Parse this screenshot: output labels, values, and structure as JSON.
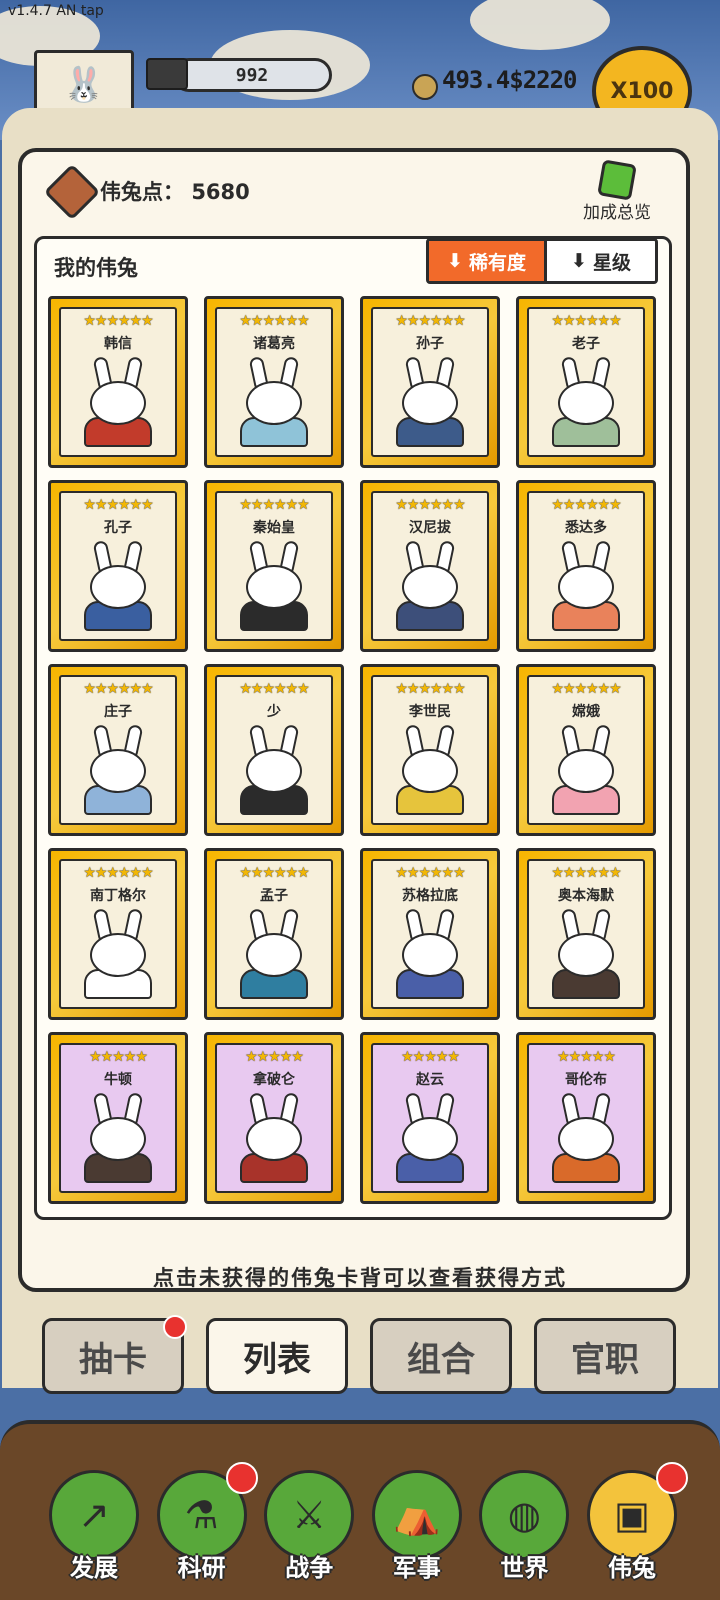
{
  "version": "v1.4.7 AN tap",
  "top_bar": {
    "troops": "992",
    "money": "493.4$2220",
    "multiplier": "X100"
  },
  "panel": {
    "points_label": "伟兔点：",
    "points_value": "5680",
    "bonus_label": "加成总览",
    "section_title": "我的伟兔",
    "sort_rarity": "稀有度",
    "sort_level": "星级"
  },
  "cards": [
    {
      "name": "韩信",
      "stars": "★★★★★★",
      "tier": "gold",
      "robe": "#c23b2b"
    },
    {
      "name": "诸葛亮",
      "stars": "★★★★★★",
      "tier": "gold",
      "robe": "#8fc3d8"
    },
    {
      "name": "孙子",
      "stars": "★★★★★★",
      "tier": "gold",
      "robe": "#3d5b8a"
    },
    {
      "name": "老子",
      "stars": "★★★★★★",
      "tier": "gold",
      "robe": "#9fbf9a"
    },
    {
      "name": "孔子",
      "stars": "★★★★★★",
      "tier": "gold",
      "robe": "#3a5fa0"
    },
    {
      "name": "秦始皇",
      "stars": "★★★★★★",
      "tier": "gold",
      "robe": "#2b2b2b"
    },
    {
      "name": "汉尼拔",
      "stars": "★★★★★★",
      "tier": "gold",
      "robe": "#3d4f7a"
    },
    {
      "name": "悉达多",
      "stars": "★★★★★★",
      "tier": "gold",
      "robe": "#e9825b"
    },
    {
      "name": "庄子",
      "stars": "★★★★★★",
      "tier": "gold",
      "robe": "#8fb3d9"
    },
    {
      "name": "少",
      "stars": "★★★★★★",
      "tier": "gold",
      "robe": "#2b2b2b"
    },
    {
      "name": "李世民",
      "stars": "★★★★★★",
      "tier": "gold",
      "robe": "#e6c43c"
    },
    {
      "name": "嫦娥",
      "stars": "★★★★★★",
      "tier": "gold",
      "robe": "#f2a3b1"
    },
    {
      "name": "南丁格尔",
      "stars": "★★★★★★",
      "tier": "gold",
      "robe": "#ffffff"
    },
    {
      "name": "孟子",
      "stars": "★★★★★★",
      "tier": "gold",
      "robe": "#2f7ea0"
    },
    {
      "name": "苏格拉底",
      "stars": "★★★★★★",
      "tier": "gold",
      "robe": "#4a5fa8"
    },
    {
      "name": "奥本海默",
      "stars": "★★★★★★",
      "tier": "gold",
      "robe": "#4a3a32"
    },
    {
      "name": "牛顿",
      "stars": "★★★★★",
      "tier": "purple",
      "robe": "#4a3a32"
    },
    {
      "name": "拿破仑",
      "stars": "★★★★★",
      "tier": "purple",
      "robe": "#a8332a"
    },
    {
      "name": "赵云",
      "stars": "★★★★★",
      "tier": "purple",
      "robe": "#4a5fa8"
    },
    {
      "name": "哥伦布",
      "stars": "★★★★★",
      "tier": "purple",
      "robe": "#d96a2a"
    }
  ],
  "hint": "点击未获得的伟兔卡背可以查看获得方式",
  "tabs": [
    {
      "label": "抽卡",
      "active": false,
      "badge": true
    },
    {
      "label": "列表",
      "active": true,
      "badge": false
    },
    {
      "label": "组合",
      "active": false,
      "badge": false
    },
    {
      "label": "官职",
      "active": false,
      "badge": false
    }
  ],
  "nav": [
    {
      "label": "发展",
      "icon": "↗",
      "badge": false,
      "active": false
    },
    {
      "label": "科研",
      "icon": "⚗",
      "badge": true,
      "active": false
    },
    {
      "label": "战争",
      "icon": "⚔",
      "badge": false,
      "active": false
    },
    {
      "label": "军事",
      "icon": "⛺",
      "badge": false,
      "active": false
    },
    {
      "label": "世界",
      "icon": "◍",
      "badge": false,
      "active": false
    },
    {
      "label": "伟兔",
      "icon": "▣",
      "badge": true,
      "active": true
    }
  ]
}
